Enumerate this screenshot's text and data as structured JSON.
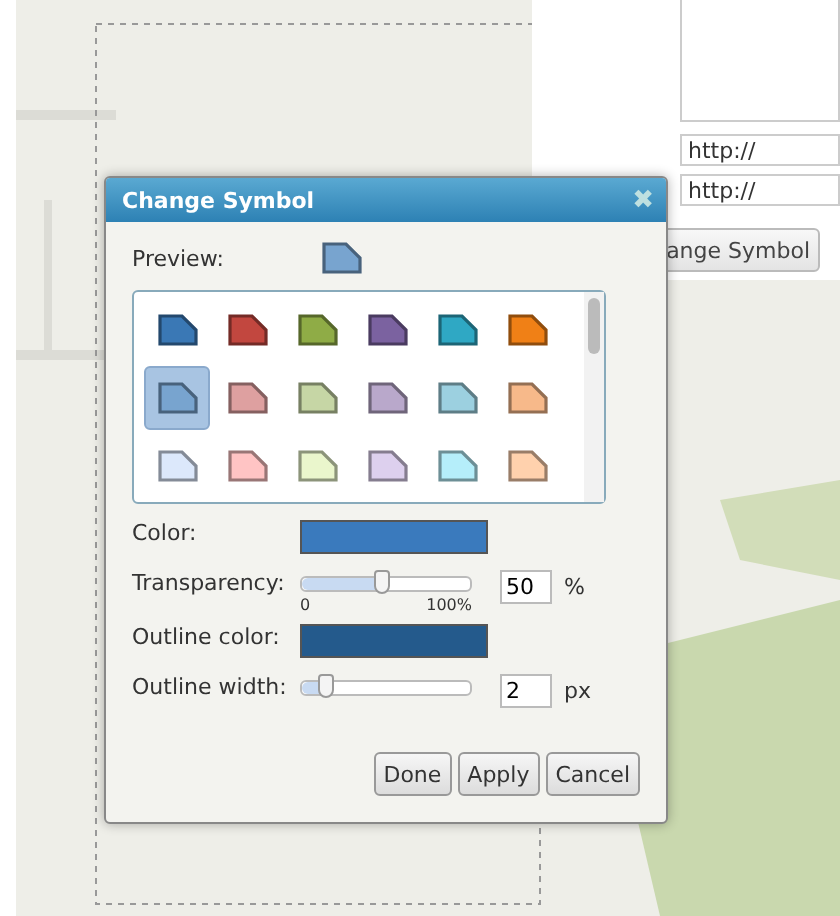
{
  "side_panel": {
    "link_fields": [
      {
        "value": "http://"
      },
      {
        "value": "http://"
      }
    ],
    "button": "ange Symbol"
  },
  "dialog": {
    "title": "Change Symbol",
    "close": "✖",
    "preview_label": "Preview:",
    "symbols": [
      [
        {
          "color": "#3a78b5",
          "selected": false
        },
        {
          "color": "#c2473f",
          "selected": false
        },
        {
          "color": "#8fac46",
          "selected": false
        },
        {
          "color": "#7b62a0",
          "selected": false
        },
        {
          "color": "#2fa8c4",
          "selected": false
        },
        {
          "color": "#f08016",
          "selected": false
        }
      ],
      [
        {
          "color": "#78a4cf",
          "selected": true
        },
        {
          "color": "#dea0a0",
          "selected": false
        },
        {
          "color": "#c6d6a5",
          "selected": false
        },
        {
          "color": "#b9a8cb",
          "selected": false
        },
        {
          "color": "#9cd0e0",
          "selected": false
        },
        {
          "color": "#f7b98a",
          "selected": false
        }
      ],
      [
        {
          "color": "#dce8fb",
          "selected": false
        },
        {
          "color": "#ffc4c4",
          "selected": false
        },
        {
          "color": "#eaf6cc",
          "selected": false
        },
        {
          "color": "#ddd0ee",
          "selected": false
        },
        {
          "color": "#b5eefa",
          "selected": false
        },
        {
          "color": "#ffd1ad",
          "selected": false
        }
      ]
    ],
    "fields": [
      {
        "kind": "swatch",
        "label": "Color:",
        "color": "#3a7abd"
      },
      {
        "kind": "slider",
        "label": "Transparency:",
        "level": 0.48,
        "min_label": "0",
        "max_label": "100%",
        "value": "50",
        "unit": "%"
      },
      {
        "kind": "swatch",
        "label": "Outline color:",
        "color": "#245a8c"
      },
      {
        "kind": "slider",
        "label": "Outline width:",
        "level": 0.14,
        "value": "2",
        "unit": "px"
      }
    ],
    "buttons": [
      "Done",
      "Apply",
      "Cancel"
    ]
  }
}
